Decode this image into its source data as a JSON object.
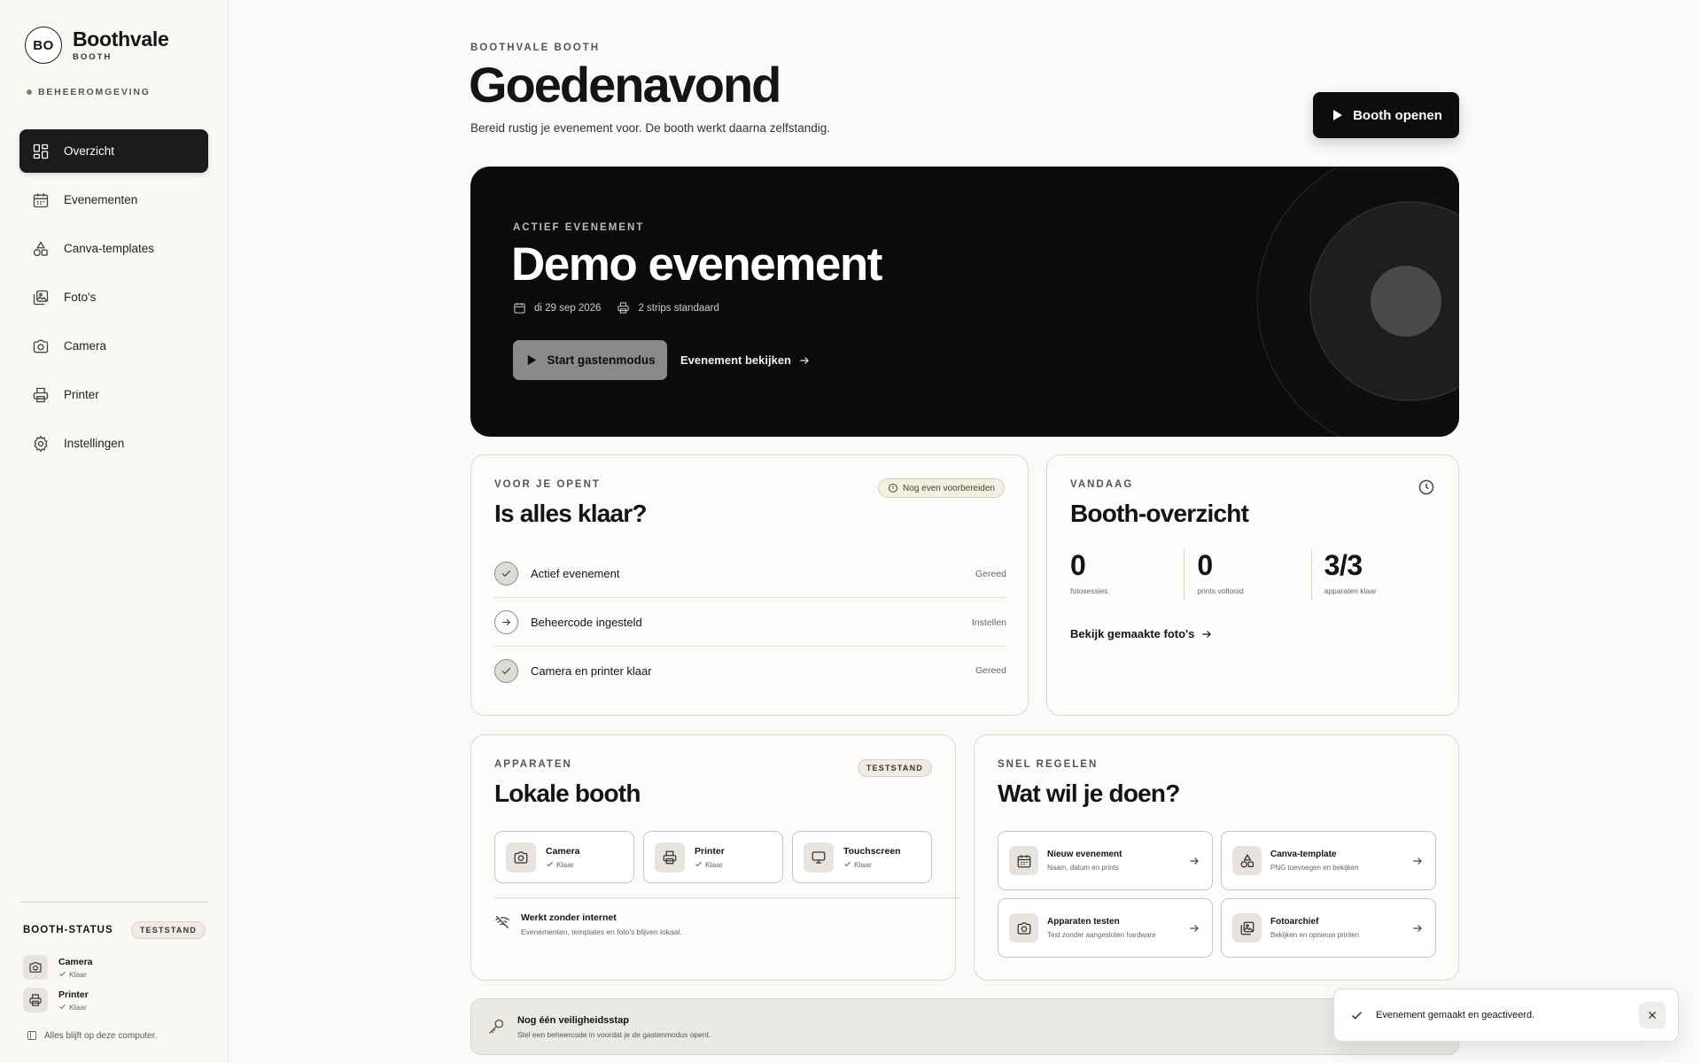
{
  "brand": {
    "logo": "BO",
    "name": "Boothvale",
    "sub": "BOOTH"
  },
  "env_label": "BEHEEROMGEVING",
  "nav": [
    {
      "label": "Overzicht",
      "icon": "dashboard-icon",
      "active": true
    },
    {
      "label": "Evenementen",
      "icon": "calendar-icon"
    },
    {
      "label": "Canva-templates",
      "icon": "shapes-icon"
    },
    {
      "label": "Foto's",
      "icon": "images-icon"
    },
    {
      "label": "Camera",
      "icon": "camera-icon"
    },
    {
      "label": "Printer",
      "icon": "printer-icon"
    },
    {
      "label": "Instellingen",
      "icon": "gear-icon"
    }
  ],
  "booth_status": {
    "title": "BOOTH-STATUS",
    "badge": "TESTSTAND",
    "devices": [
      {
        "name": "Camera",
        "status": "Klaar"
      },
      {
        "name": "Printer",
        "status": "Klaar"
      }
    ],
    "footer": "Alles blijft op deze computer."
  },
  "header": {
    "eyebrow": "BOOTHVALE BOOTH",
    "title": "Goedenavond",
    "subtitle": "Bereid rustig je evenement voor. De booth werkt daarna zelfstandig.",
    "open_button": "Booth openen"
  },
  "hero": {
    "eyebrow": "ACTIEF EVENEMENT",
    "title": "Demo evenement",
    "date": "di 29 sep 2026",
    "prints": "2 strips standaard",
    "start_button": "Start gastenmodus",
    "view_link": "Evenement bekijken"
  },
  "checklist": {
    "eyebrow": "VOOR JE OPENT",
    "title": "Is alles klaar?",
    "badge": "Nog even voorbereiden",
    "items": [
      {
        "label": "Actief evenement",
        "status": "Gereed",
        "done": true
      },
      {
        "label": "Beheercode ingesteld",
        "status": "Instellen",
        "done": false
      },
      {
        "label": "Camera en printer klaar",
        "status": "Gereed",
        "done": true
      }
    ]
  },
  "today": {
    "eyebrow": "VANDAAG",
    "title": "Booth-overzicht",
    "stats": [
      {
        "value": "0",
        "label": "fotosessies"
      },
      {
        "value": "0",
        "label": "prints voltooid"
      },
      {
        "value": "3/3",
        "label": "apparaten klaar"
      }
    ],
    "link": "Bekijk gemaakte foto's"
  },
  "devices": {
    "eyebrow": "APPARATEN",
    "title": "Lokale booth",
    "badge": "TESTSTAND",
    "items": [
      {
        "name": "Camera",
        "status": "Klaar"
      },
      {
        "name": "Printer",
        "status": "Klaar"
      },
      {
        "name": "Touchscreen",
        "status": "Klaar"
      }
    ],
    "offline_title": "Werkt zonder internet",
    "offline_sub": "Evenementen, templates en foto's blijven lokaal."
  },
  "quick": {
    "eyebrow": "SNEL REGELEN",
    "title": "Wat wil je doen?",
    "actions": [
      {
        "name": "Nieuw evenement",
        "desc": "Naam, datum en prints"
      },
      {
        "name": "Canva-template",
        "desc": "PNG toevoegen en bekijken"
      },
      {
        "name": "Apparaten testen",
        "desc": "Test zonder aangesloten hardware"
      },
      {
        "name": "Fotoarchief",
        "desc": "Bekijken en opnieuw printen"
      }
    ]
  },
  "security": {
    "title": "Nog één veiligheidsstap",
    "sub": "Stel een beheercode in voordat je de gastenmodus opent."
  },
  "toast": {
    "message": "Evenement gemaakt en geactiveerd."
  }
}
